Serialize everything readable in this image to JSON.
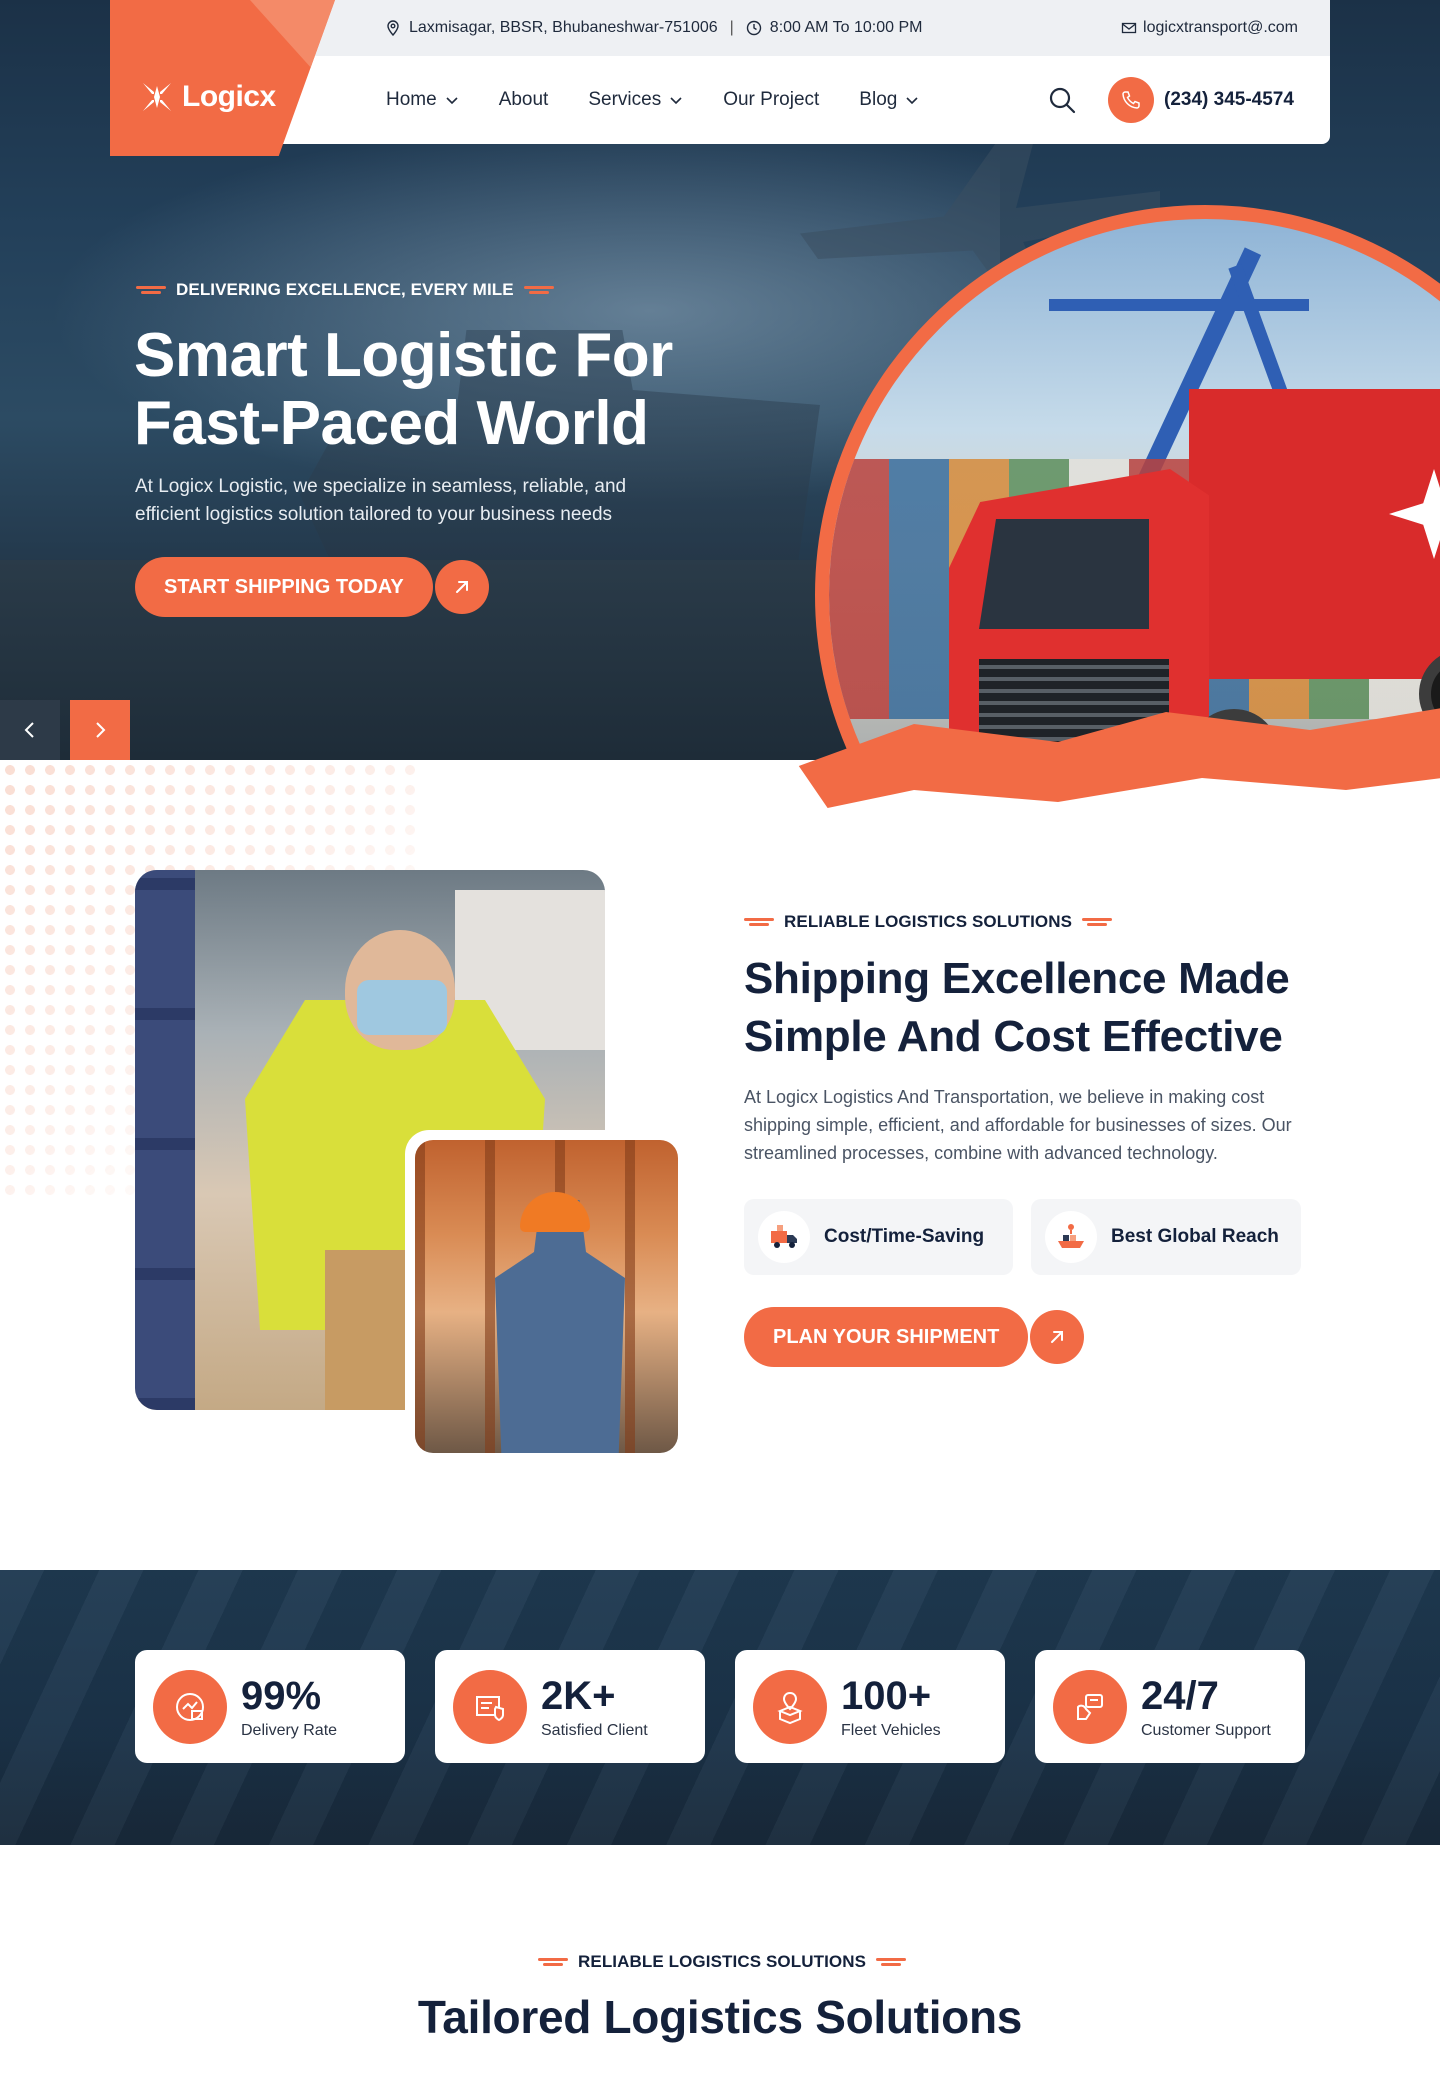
{
  "topbar": {
    "address": "Laxmisagar, BBSR, Bhubaneshwar-751006",
    "hours": "8:00 AM To 10:00 PM",
    "separator": "|",
    "email": "logicxtransport@.com"
  },
  "brand": {
    "name": "Logicx"
  },
  "nav": {
    "items": [
      {
        "label": "Home",
        "dropdown": true
      },
      {
        "label": "About",
        "dropdown": false
      },
      {
        "label": "Services",
        "dropdown": true
      },
      {
        "label": "Our Project",
        "dropdown": false
      },
      {
        "label": "Blog",
        "dropdown": true
      }
    ],
    "phone": "(234) 345-4574"
  },
  "hero": {
    "tagline": "DELIVERING EXCELLENCE, EVERY MILE",
    "title_line1": "Smart Logistic For",
    "title_line2": "Fast-Paced World",
    "description": "At Logicx Logistic, we specialize in seamless, reliable, and efficient logistics solution tailored to your business needs",
    "cta": "START SHIPPING TODAY"
  },
  "about": {
    "tagline": "RELIABLE LOGISTICS SOLUTIONS",
    "title": "Shipping Excellence Made Simple And Cost Effective",
    "description": "At Logicx Logistics And Transportation, we believe in making cost shipping simple, efficient, and affordable for businesses of sizes. Our streamlined processes, combine with advanced technology.",
    "features": [
      {
        "label": "Cost/Time-Saving",
        "icon": "truck-icon"
      },
      {
        "label": "Best Global Reach",
        "icon": "ship-icon"
      }
    ],
    "cta": "PLAN YOUR SHIPMENT"
  },
  "stats": [
    {
      "value": "99%",
      "label": "Delivery Rate",
      "icon": "delivery-icon"
    },
    {
      "value": "2K+",
      "label": "Satisfied Client",
      "icon": "client-icon"
    },
    {
      "value": "100+",
      "label": "Fleet Vehicles",
      "icon": "fleet-icon"
    },
    {
      "value": "24/7",
      "label": "Customer Support",
      "icon": "support-icon"
    }
  ],
  "solutions": {
    "tagline": "RELIABLE LOGISTICS SOLUTIONS",
    "title": "Tailored Logistics Solutions"
  },
  "colors": {
    "accent": "#f26b45",
    "navy": "#14213b",
    "hero_bg": "#23405a"
  }
}
